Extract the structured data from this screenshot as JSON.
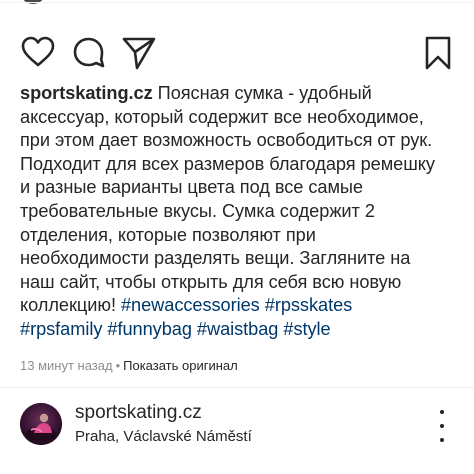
{
  "actions": {
    "like": "heart-icon",
    "comment": "comment-icon",
    "share": "share-icon",
    "save": "bookmark-icon"
  },
  "caption": {
    "username": "sportskating.cz",
    "text_lines": [
      "Поясная сумка - удобный",
      "аксессуар, который содержит все необходимое,",
      "при этом дает возможность освободиться от рук.",
      "Подходит для всех размеров благодаря ремешку",
      "и разные варианты цвета под все самые",
      "требовательные вкусы. Сумка содержит 2",
      "отделения, которые позволяют при",
      "необходимости разделять вещи. Загляните на",
      "наш сайт, чтобы открыть для себя всю новую",
      "коллекцию!"
    ],
    "hashtags": [
      "#newaccessories",
      "#rpsskates",
      "#rpsfamily",
      "#funnybag",
      "#waistbag",
      "#style"
    ]
  },
  "meta": {
    "timestamp": "13 минут назад",
    "separator": "•",
    "show_original": "Показать оригинал"
  },
  "profile": {
    "name": "sportskating.cz",
    "location": "Praha, Václavské Náměstí",
    "more_icon": "more-vertical-icon"
  },
  "colors": {
    "text": "#262626",
    "hashtag": "#00376b",
    "muted": "#8e8e8e"
  }
}
